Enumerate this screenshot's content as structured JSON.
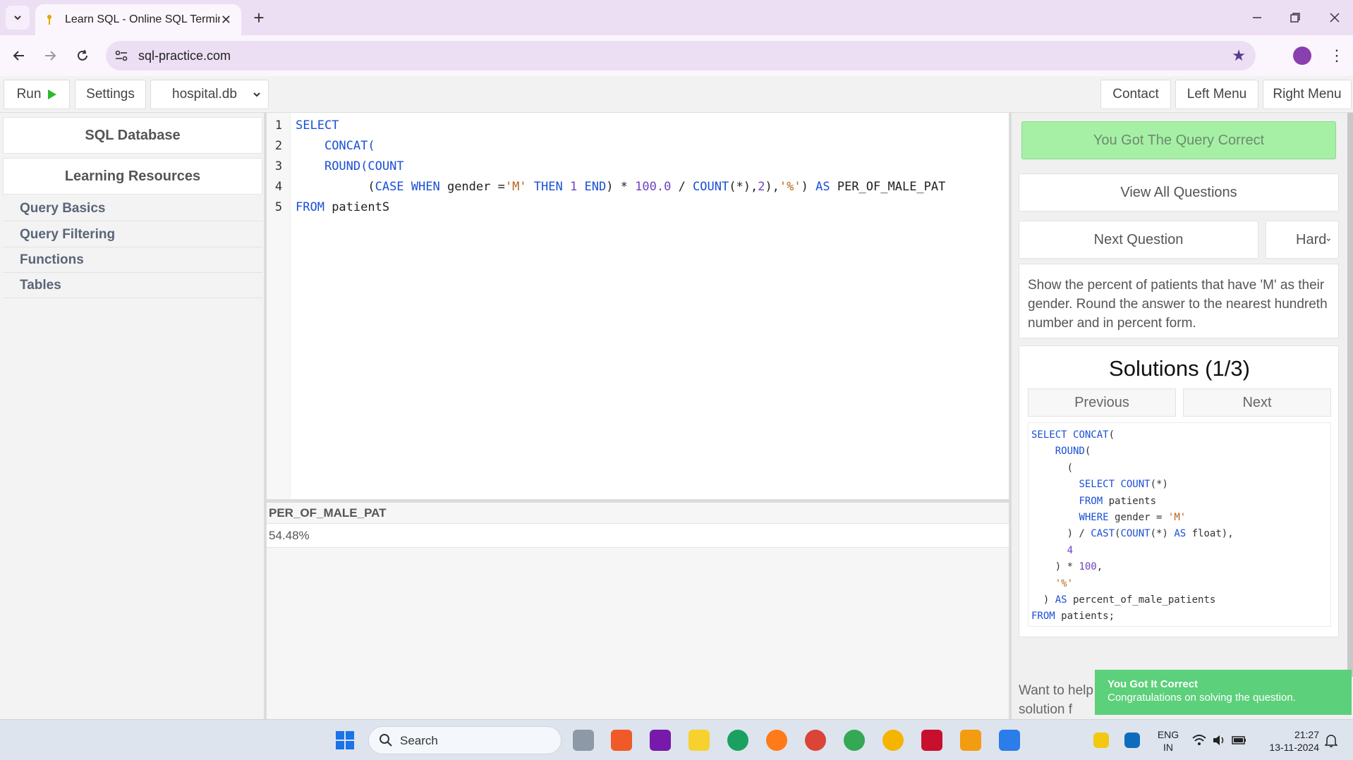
{
  "browser": {
    "tab_title": "Learn SQL - Online SQL Terminal",
    "url": "sql-practice.com"
  },
  "toolbar": {
    "run_label": "Run",
    "settings_label": "Settings",
    "database": "hospital.db",
    "contact_label": "Contact",
    "left_menu_label": "Left Menu",
    "right_menu_label": "Right Menu"
  },
  "sidebar": {
    "sql_database": "SQL Database",
    "learning_resources": "Learning Resources",
    "items": [
      {
        "label": "Query Basics"
      },
      {
        "label": "Query Filtering"
      },
      {
        "label": "Functions"
      },
      {
        "label": "Tables"
      }
    ]
  },
  "editor": {
    "line_numbers": [
      "1",
      "2",
      "3",
      "4",
      "5"
    ],
    "line1": {
      "kw": "SELECT"
    },
    "line2": {
      "indent": "    ",
      "fn": "CONCAT("
    },
    "line3": {
      "indent": "    ",
      "fn": "ROUND(COUNT"
    },
    "line4": {
      "indent": "          (",
      "kw1": "CASE WHEN",
      "t1": " gender =",
      "s1": "'M'",
      "kw2": " THEN ",
      "n1": "1",
      "kw3": " END",
      "t2": ") * ",
      "n2": "100.0",
      "t3": " / ",
      "kw4": "COUNT",
      "t4": "(*),",
      "n3": "2",
      "t5": "),",
      "s2": "'%'",
      "t6": ") ",
      "kw5": "AS",
      "t7": " PER_OF_MALE_PAT"
    },
    "line5": {
      "kw": "FROM",
      "rest": " patientS"
    }
  },
  "results": {
    "column": "PER_OF_MALE_PAT",
    "value": "54.48%"
  },
  "right_panel": {
    "correct_banner": "You Got The Query Correct",
    "view_all": "View All Questions",
    "next_question": "Next Question",
    "difficulty": "Hard",
    "question": "Show the percent of patients that have 'M' as their gender. Round the answer to the nearest hundreth number and in percent form.",
    "solutions_title": "Solutions (1/3)",
    "previous_label": "Previous",
    "next_label": "Next",
    "solution_code": [
      "SELECT CONCAT(",
      "    ROUND(",
      "      (",
      "        SELECT COUNT(*)",
      "        FROM patients",
      "        WHERE gender = 'M'",
      "      ) / CAST(COUNT(*) AS float),",
      "      4",
      "    ) * 100,",
      "    '%'",
      "  ) AS percent_of_male_patients",
      "FROM patients;"
    ],
    "help_text": "Want to help solution f"
  },
  "toast": {
    "title": "You Got It Correct",
    "message": "Congratulations on solving the question."
  },
  "taskbar": {
    "search_label": "Search",
    "lang_top": "ENG",
    "lang_bottom": "IN",
    "time": "21:27",
    "date": "13-11-2024"
  },
  "colors": {
    "keyword": "#1a4fd6",
    "string": "#b5651d",
    "number": "#6f42c1",
    "success": "#a6f0a6",
    "toast": "#5cd07a"
  }
}
